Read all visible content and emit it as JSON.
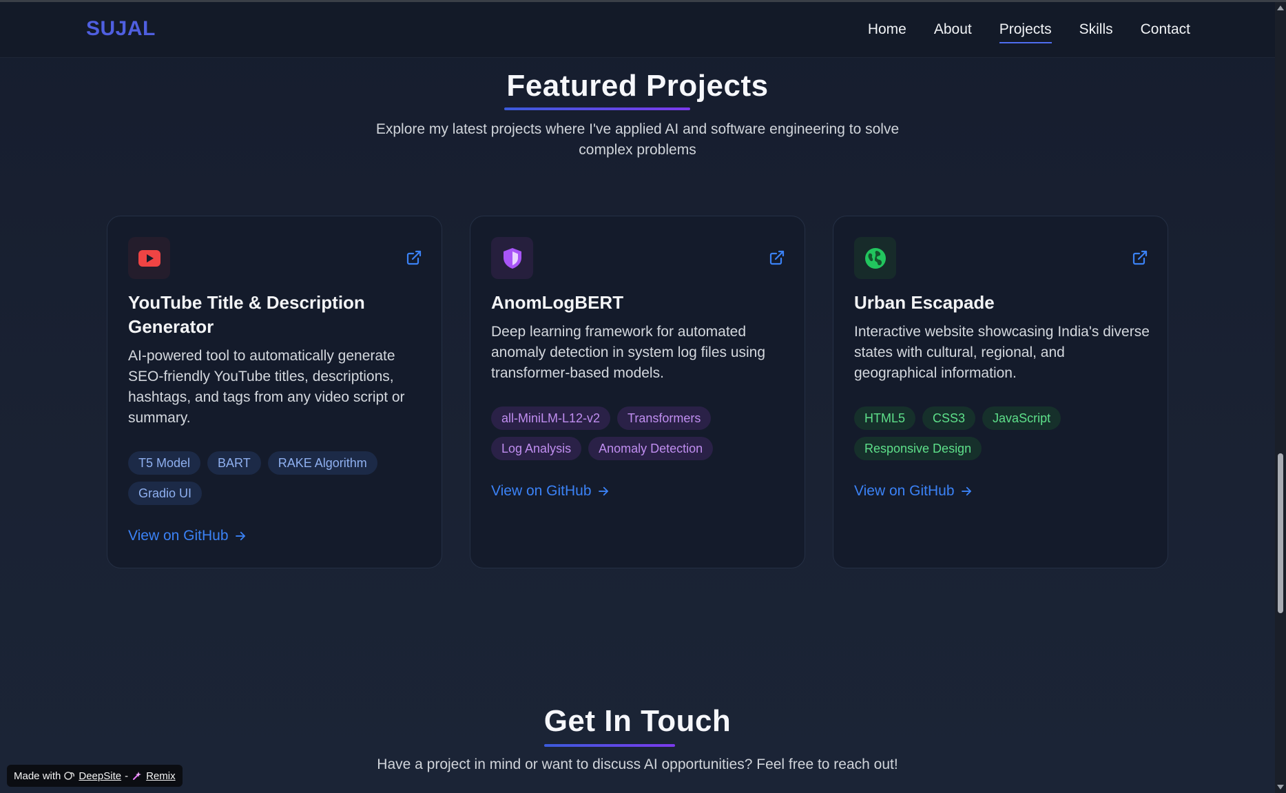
{
  "nav": {
    "logo": "SUJAL",
    "links": [
      "Home",
      "About",
      "Projects",
      "Skills",
      "Contact"
    ],
    "active": "Projects"
  },
  "projects_section": {
    "title": "Featured Projects",
    "subtitle_line1": "Explore my latest projects where I've applied AI and software engineering to solve",
    "subtitle_line2": "complex problems"
  },
  "projects": [
    {
      "icon": "youtube-icon",
      "title": "YouTube Title & Description Generator",
      "description": "AI-powered tool to automatically generate SEO-friendly YouTube titles, descriptions, hashtags, and tags from any video script or summary.",
      "tags": [
        "T5 Model",
        "BART",
        "RAKE Algorithm",
        "Gradio UI"
      ],
      "link": "View on GitHub",
      "accent": "#ef4444"
    },
    {
      "icon": "shield-icon",
      "title": "AnomLogBERT",
      "description": "Deep learning framework for automated anomaly detection in system log files using transformer-based models.",
      "tags": [
        "all-MiniLM-L12-v2",
        "Transformers",
        "Log Analysis",
        "Anomaly Detection"
      ],
      "link": "View on GitHub",
      "accent": "#a855f7"
    },
    {
      "icon": "globe-icon",
      "title": "Urban Escapade",
      "description": "Interactive website showcasing India's diverse states with cultural, regional, and geographical information.",
      "tags": [
        "HTML5",
        "CSS3",
        "JavaScript",
        "Responsive Design"
      ],
      "link": "View on GitHub",
      "accent": "#22c55e"
    }
  ],
  "contact_section": {
    "title": "Get In Touch",
    "subtitle": "Have a project in mind or want to discuss AI opportunities? Feel free to reach out!"
  },
  "badge": {
    "made_with": "Made with",
    "deepsite": "DeepSite",
    "separator": "-",
    "remix": "Remix"
  },
  "colors": {
    "background": "#1a2233",
    "card": "#141b2b",
    "link": "#3b82f6",
    "logo": "#4f5fe0"
  }
}
